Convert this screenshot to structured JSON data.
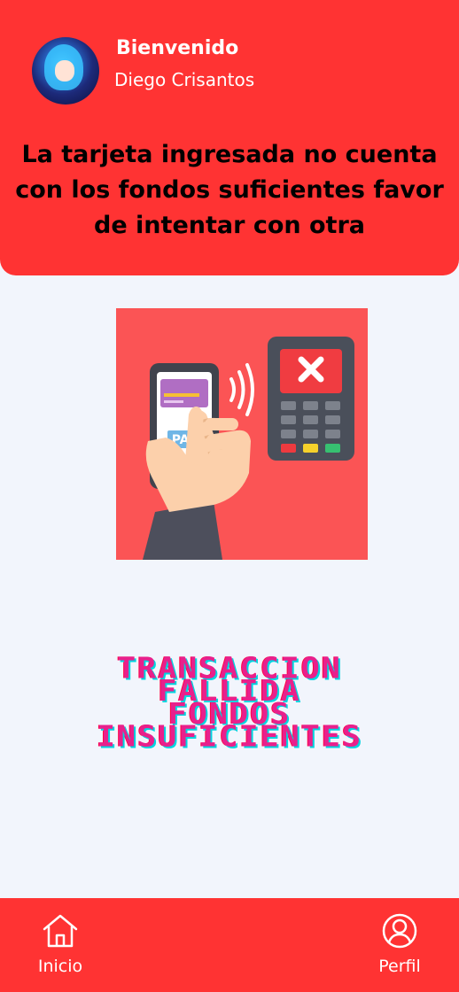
{
  "header": {
    "welcome": "Bienvenido",
    "username": "Diego Crisantos",
    "message": "La tarjeta ingresada no cuenta con los fondos suficientes favor de intentar con otra"
  },
  "illustration": {
    "icon": "payment-declined-illustration",
    "button_text": "PAY"
  },
  "status": {
    "lines": [
      "TRANSACCION",
      "FALLIDA",
      "FONDOS",
      "INSUFICIENTES"
    ]
  },
  "nav": {
    "home_label": "Inicio",
    "home_icon": "home-icon",
    "profile_label": "Perfil",
    "profile_icon": "user-circle-icon"
  },
  "colors": {
    "primary": "#ff3333",
    "background": "#f2f5fc",
    "status_text": "#e8208c",
    "status_shadow": "#00d5e0"
  }
}
